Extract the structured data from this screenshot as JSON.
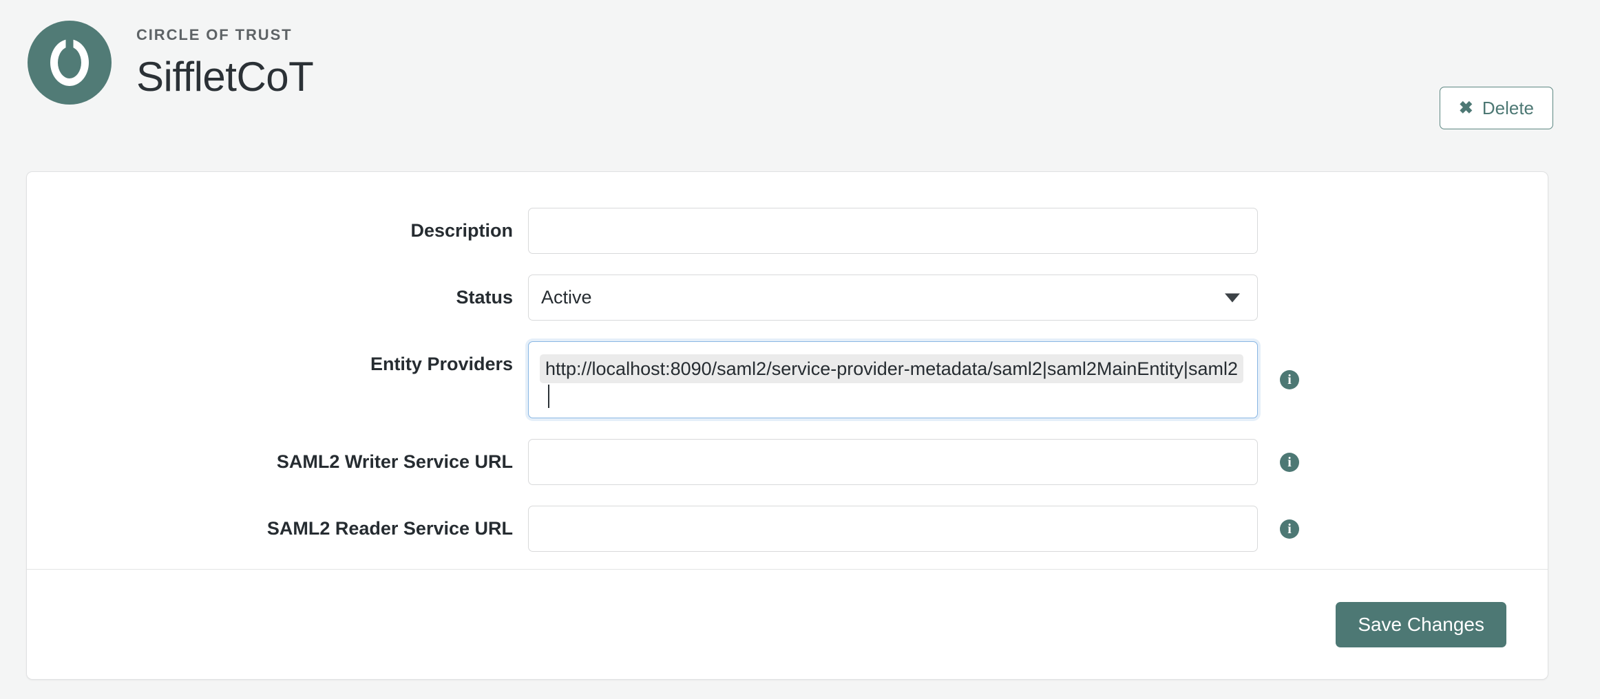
{
  "header": {
    "eyebrow": "CIRCLE OF TRUST",
    "title": "SiffletCoT",
    "logo_icon": "circle-power-ring-logo",
    "delete_button": {
      "label": "Delete",
      "icon": "close-x-icon"
    }
  },
  "theme": {
    "accent": "#4d7874",
    "logo_bg": "#517b76",
    "page_bg": "#f4f5f5",
    "card_bg": "#ffffff",
    "border": "#d8d9da",
    "focus_border": "#88b6e3",
    "chip_bg": "#ebebeb",
    "label_color": "#262c31",
    "eyebrow_color": "#5e6366"
  },
  "form": {
    "description": {
      "label": "Description",
      "value": "",
      "placeholder": ""
    },
    "status": {
      "label": "Status",
      "value": "Active",
      "options": [
        "Active"
      ],
      "arrow_icon": "chevron-down-icon"
    },
    "entity_providers": {
      "label": "Entity Providers",
      "tags": [
        "http://localhost:8090/saml2/service-provider-metadata/saml2|saml2MainEntity|saml2"
      ],
      "value": "",
      "placeholder": "",
      "info_icon": "info-circle-icon",
      "focused": true
    },
    "saml2_writer_service_url": {
      "label": "SAML2 Writer Service URL",
      "value": "",
      "placeholder": "",
      "info_icon": "info-circle-icon"
    },
    "saml2_reader_service_url": {
      "label": "SAML2 Reader Service URL",
      "value": "",
      "placeholder": "",
      "info_icon": "info-circle-icon"
    }
  },
  "footer": {
    "save_label": "Save Changes"
  },
  "icons": {
    "info_glyph": "i",
    "close_glyph": "✖"
  }
}
